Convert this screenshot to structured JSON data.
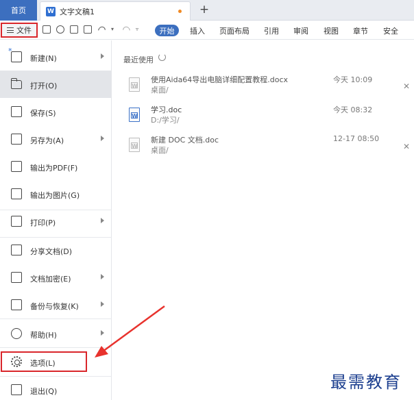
{
  "titlebar": {
    "home_tab": "首页",
    "doc_tab": "文字文稿1",
    "doc_icon": "W",
    "new_tab_label": "+"
  },
  "ribbon": {
    "file_button": "文件",
    "start_tab": "开始",
    "tabs": [
      "插入",
      "页面布局",
      "引用",
      "审阅",
      "视图",
      "章节",
      "安全"
    ]
  },
  "file_menu": {
    "items": [
      {
        "label": "新建(N)",
        "icon": "new-doc-icon",
        "submenu": true
      },
      {
        "label": "打开(O)",
        "icon": "folder-icon",
        "submenu": false,
        "active": true
      },
      {
        "label": "保存(S)",
        "icon": "save-icon",
        "submenu": false
      },
      {
        "label": "另存为(A)",
        "icon": "save-as-icon",
        "submenu": true
      },
      {
        "label": "输出为PDF(F)",
        "icon": "pdf-icon",
        "submenu": false
      },
      {
        "label": "输出为图片(G)",
        "icon": "image-icon",
        "submenu": false
      },
      {
        "label": "打印(P)",
        "icon": "print-icon",
        "submenu": true
      },
      {
        "label": "分享文档(D)",
        "icon": "share-icon",
        "submenu": false
      },
      {
        "label": "文档加密(E)",
        "icon": "encrypt-icon",
        "submenu": true
      },
      {
        "label": "备份与恢复(K)",
        "icon": "backup-icon",
        "submenu": true
      },
      {
        "label": "帮助(H)",
        "icon": "help-icon",
        "submenu": true
      },
      {
        "label": "选项(L)",
        "icon": "gear-icon",
        "submenu": false
      },
      {
        "label": "退出(Q)",
        "icon": "exit-icon",
        "submenu": false
      }
    ]
  },
  "recent": {
    "title": "最近使用",
    "files": [
      {
        "name": "使用Aida64导出电脑详细配置教程.docx",
        "path": "桌面/",
        "time": "今天 10:09",
        "closable": true
      },
      {
        "name": "学习.doc",
        "path": "D:/学习/",
        "time": "今天 08:32",
        "closable": false
      },
      {
        "name": "新建 DOC 文档.doc",
        "path": "桌面/",
        "time": "12-17 08:50",
        "closable": true
      }
    ]
  },
  "watermark": "最需教育",
  "colors": {
    "accent": "#3c6fbf",
    "highlight_red": "#d9252a"
  }
}
